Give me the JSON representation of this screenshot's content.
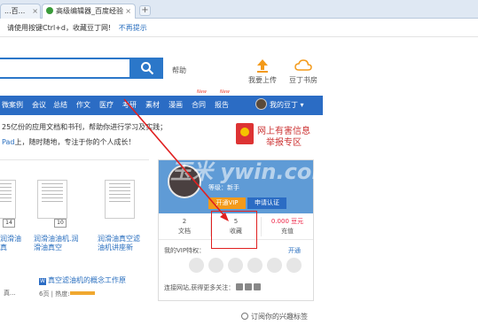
{
  "browser": {
    "tabs": [
      {
        "label": "...百...",
        "active": false
      },
      {
        "label": "高级编辑器_百度经验",
        "active": true
      }
    ],
    "new_tab": "+",
    "close": "×"
  },
  "notice": {
    "text": "请使用按键Ctrl+d，收藏豆丁网!",
    "dismiss": "不再提示"
  },
  "header": {
    "help": "帮助",
    "upload": "我要上传",
    "books": "豆丁书房"
  },
  "nav": {
    "items": [
      {
        "label": "微案例"
      },
      {
        "label": "会议"
      },
      {
        "label": "总结"
      },
      {
        "label": "作文"
      },
      {
        "label": "医疗"
      },
      {
        "label": "考研"
      },
      {
        "label": "素材"
      },
      {
        "label": "漫画"
      },
      {
        "label": "合同",
        "badge": "New"
      },
      {
        "label": "报告",
        "badge": "New"
      }
    ],
    "mine": "我的豆丁 ▾"
  },
  "intro": {
    "line1": "25亿份的应用文档和书刊，帮助你进行学习及实践；",
    "line2_hl": "Pad",
    "line2": "上，随时随地，专注于你的个人成长！"
  },
  "report": {
    "line1": "网上有害信息",
    "line2": "举报专区"
  },
  "docs": {
    "pages": [
      "14",
      "10",
      ""
    ],
    "titles": [
      "润滑油真",
      "润滑油油机.润滑油真空",
      "润滑油真空滤油机讲座新"
    ],
    "item4": "真空滤油机的概念工作原",
    "meta1": "真...",
    "meta2": "6页 | 热度:"
  },
  "card": {
    "level": "等级：新手",
    "vip_btn": "开通VIP",
    "cert_btn": "申请认证",
    "stats": [
      {
        "value": "2",
        "label": "文档"
      },
      {
        "value": "5",
        "label": "收藏"
      },
      {
        "value": "0.000 豆元",
        "label": "充值"
      }
    ],
    "vip_label": "我的VIP特权：",
    "vip_open": "开通",
    "follow": "连接网站,获得更多关注："
  },
  "subscribe": "订阅你的兴趣标签",
  "watermark": "玉米 ywin.com",
  "colors": {
    "nav": "#2b6cc4",
    "accent": "#f39a1a",
    "highlight": "#e02020"
  }
}
